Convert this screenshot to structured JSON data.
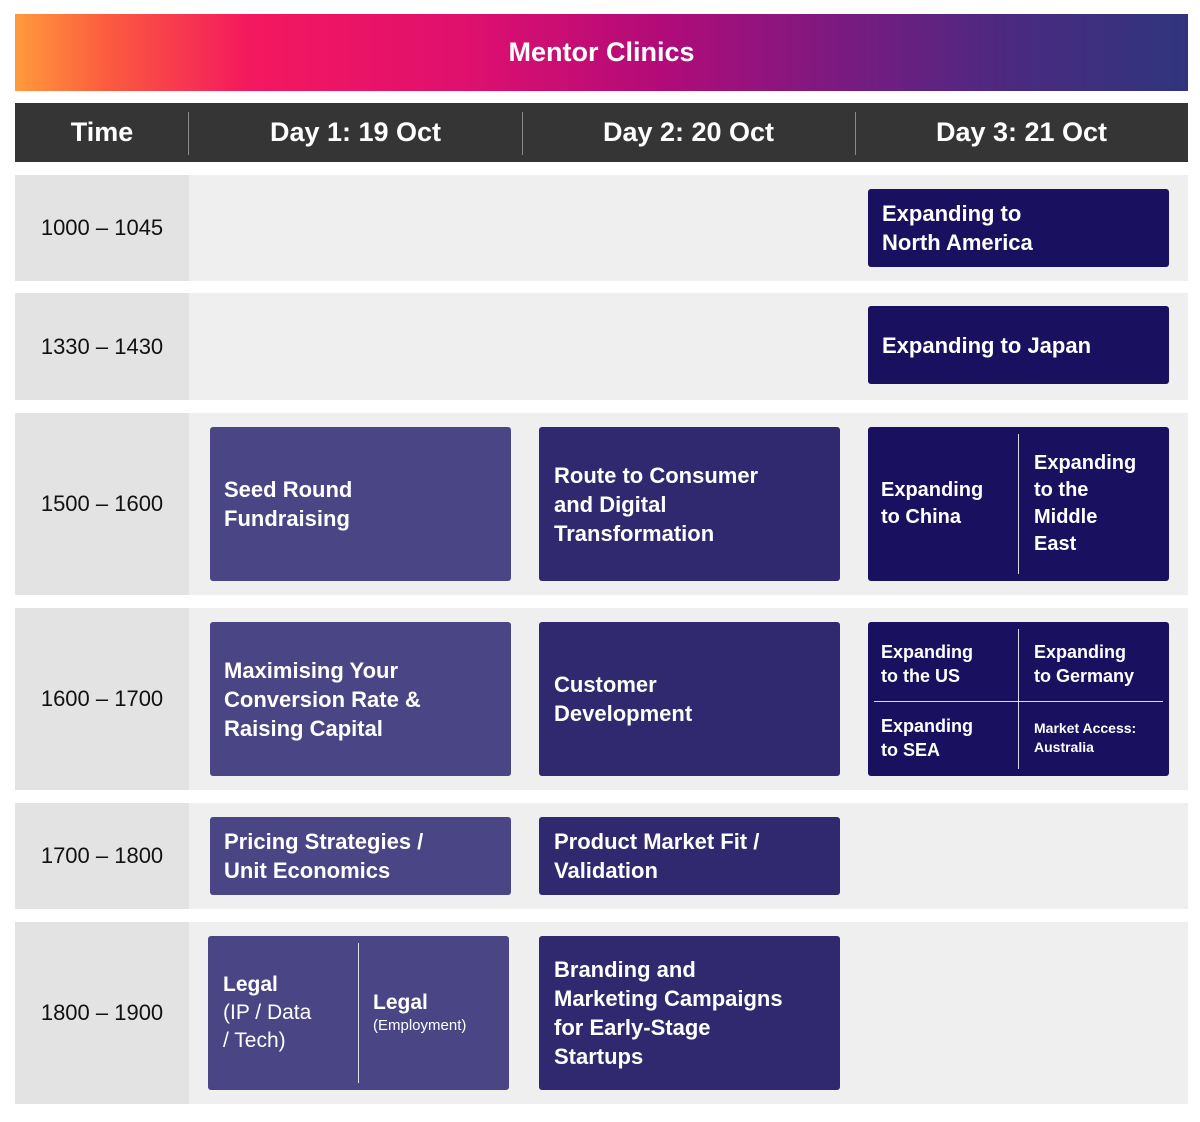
{
  "title": "Mentor Clinics",
  "header": {
    "time": "Time",
    "day1": "Day 1: 19 Oct",
    "day2": "Day 2: 20 Oct",
    "day3": "Day 3: 21 Oct"
  },
  "colors": {
    "gradient_start": "#ff9a3c",
    "gradient_mid": "#e0106e",
    "gradient_end": "#2f357d",
    "header_bg": "#353535",
    "day1_card": "#4a4585",
    "day2_card": "#30296f",
    "day3_card": "#1a1060"
  },
  "rows": [
    {
      "time": "1000 – 1045",
      "day3": {
        "line1": "Expanding to",
        "line2": "North America"
      }
    },
    {
      "time": "1330 – 1430",
      "day3": {
        "title": "Expanding to Japan"
      }
    },
    {
      "time": "1500 – 1600",
      "day1": {
        "line1": "Seed Round",
        "line2": "Fundraising"
      },
      "day2": {
        "line1": "Route to Consumer",
        "line2": "and Digital",
        "line3": "Transformation"
      },
      "day3": {
        "left": {
          "line1": "Expanding",
          "line2": "to China"
        },
        "right": {
          "line1": "Expanding",
          "line2": "to the",
          "line3": "Middle",
          "line4": "East"
        }
      }
    },
    {
      "time": "1600 – 1700",
      "day1": {
        "line1": "Maximising Your",
        "line2": "Conversion Rate &",
        "line3": "Raising Capital"
      },
      "day2": {
        "line1": "Customer",
        "line2": "Development"
      },
      "day3": {
        "top_left": {
          "line1": "Expanding",
          "line2": "to the US"
        },
        "top_right": {
          "line1": "Expanding",
          "line2": "to Germany"
        },
        "bottom_left": {
          "line1": "Expanding",
          "line2": "to SEA"
        },
        "bottom_right": {
          "line1": "Market Access:",
          "line2": "Australia"
        }
      }
    },
    {
      "time": "1700 – 1800",
      "day1": {
        "line1": "Pricing Strategies /",
        "line2": "Unit Economics"
      },
      "day2": {
        "line1": "Product Market Fit /",
        "line2": "Validation"
      }
    },
    {
      "time": "1800 – 1900",
      "day1": {
        "left": {
          "line1": "Legal",
          "line2": "(IP / Data",
          "line3": "/ Tech)"
        },
        "right": {
          "line1": "Legal",
          "line2": "(Employment)"
        }
      },
      "day2": {
        "line1": "Branding and",
        "line2": "Marketing Campaigns",
        "line3": "for Early-Stage",
        "line4": "Startups"
      }
    }
  ]
}
